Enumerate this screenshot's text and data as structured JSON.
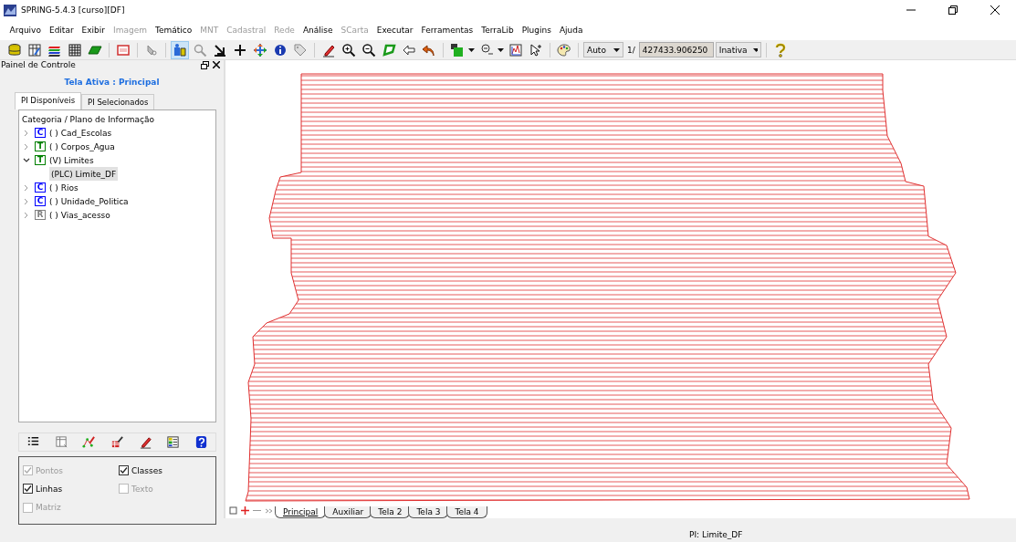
{
  "window": {
    "title": "SPRING-5.4.3 [curso][DF]"
  },
  "menu": [
    {
      "label": "Arquivo",
      "disabled": false
    },
    {
      "label": "Editar",
      "disabled": false
    },
    {
      "label": "Exibir",
      "disabled": false
    },
    {
      "label": "Imagem",
      "disabled": true
    },
    {
      "label": "Temático",
      "disabled": false
    },
    {
      "label": "MNT",
      "disabled": true
    },
    {
      "label": "Cadastral",
      "disabled": true
    },
    {
      "label": "Rede",
      "disabled": true
    },
    {
      "label": "Análise",
      "disabled": false
    },
    {
      "label": "SCarta",
      "disabled": true
    },
    {
      "label": "Executar",
      "disabled": false
    },
    {
      "label": "Ferramentas",
      "disabled": false
    },
    {
      "label": "TerraLib",
      "disabled": false
    },
    {
      "label": "Plugins",
      "disabled": false
    },
    {
      "label": "Ajuda",
      "disabled": false
    }
  ],
  "toolbar": [
    {
      "kind": "database",
      "selected": false
    },
    {
      "kind": "tableedit",
      "selected": false
    },
    {
      "kind": "layers",
      "selected": false
    },
    {
      "kind": "grid",
      "selected": false
    },
    {
      "kind": "parallelogram",
      "selected": false
    },
    {
      "kind": "sep"
    },
    {
      "kind": "window",
      "selected": false
    },
    {
      "kind": "sep"
    },
    {
      "kind": "graytool",
      "selected": false
    },
    {
      "kind": "sep"
    },
    {
      "kind": "cursor",
      "selected": true
    },
    {
      "kind": "magnifier",
      "selected": false
    },
    {
      "kind": "arrowcorner",
      "selected": false
    },
    {
      "kind": "plus",
      "selected": false
    },
    {
      "kind": "move",
      "selected": false
    },
    {
      "kind": "info",
      "selected": false
    },
    {
      "kind": "tag",
      "selected": false
    },
    {
      "kind": "sep"
    },
    {
      "kind": "pencil",
      "selected": false
    },
    {
      "kind": "zoomin",
      "selected": false
    },
    {
      "kind": "zoomout",
      "selected": false
    },
    {
      "kind": "lasso",
      "selected": false
    },
    {
      "kind": "arrowleft",
      "selected": false
    },
    {
      "kind": "undo",
      "selected": false
    },
    {
      "kind": "sep"
    },
    {
      "kind": "greenbox",
      "selected": false
    },
    {
      "kind": "caret"
    },
    {
      "kind": "scale",
      "selected": false
    },
    {
      "kind": "caret"
    },
    {
      "kind": "chart",
      "selected": false
    },
    {
      "kind": "pointer",
      "selected": false
    },
    {
      "kind": "sep"
    },
    {
      "kind": "palette",
      "selected": false
    },
    {
      "kind": "sep"
    }
  ],
  "scale": {
    "mode": "Auto",
    "prefix": "1/",
    "value": "427433.906250",
    "state": "Inativa"
  },
  "control_panel": {
    "title": "Painel de Controle",
    "active_screen": "Tela Ativa : Principal",
    "tabs": [
      {
        "label": "PI Disponíveis",
        "selected": true
      },
      {
        "label": "PI Selecionados",
        "selected": false
      }
    ],
    "tree_header": "Categoria / Plano de Informação",
    "tree": [
      {
        "badge": "C",
        "color": "#0000ff",
        "label": "( ) Cad_Escolas",
        "expanded": false
      },
      {
        "badge": "T",
        "color": "#008000",
        "label": "( ) Corpos_Agua",
        "expanded": false
      },
      {
        "badge": "T",
        "color": "#008000",
        "label": "(V) Limites",
        "expanded": true,
        "children": [
          {
            "label": "(PLC) Limite_DF",
            "selected": true
          }
        ]
      },
      {
        "badge": "C",
        "color": "#0000ff",
        "label": "( ) Rios",
        "expanded": false
      },
      {
        "badge": "C",
        "color": "#0000ff",
        "label": "( ) Unidade_Politica",
        "expanded": false
      },
      {
        "badge": "R",
        "color": "#808080",
        "label": "( ) Vias_acesso",
        "expanded": false
      }
    ],
    "tools": [
      {
        "kind": "list"
      },
      {
        "kind": "table"
      },
      {
        "kind": "vectoredit"
      },
      {
        "kind": "chartedit"
      },
      {
        "kind": "pencil"
      },
      {
        "kind": "colortable"
      },
      {
        "kind": "help"
      }
    ],
    "options": [
      {
        "label": "Pontos",
        "checked": true,
        "disabled": true
      },
      {
        "label": "Classes",
        "checked": true,
        "disabled": false
      },
      {
        "label": "Linhas",
        "checked": true,
        "disabled": false
      },
      {
        "label": "Texto",
        "checked": false,
        "disabled": true
      },
      {
        "label": "Matriz",
        "checked": false,
        "disabled": true
      }
    ]
  },
  "screen_tabs": [
    {
      "label": "Principal",
      "selected": true
    },
    {
      "label": "Auxiliar",
      "selected": false
    },
    {
      "label": "Tela 2",
      "selected": false
    },
    {
      "label": "Tela 3",
      "selected": false
    },
    {
      "label": "Tela 4",
      "selected": false
    }
  ],
  "status_bar": {
    "text": "PI: Limite_DF"
  }
}
